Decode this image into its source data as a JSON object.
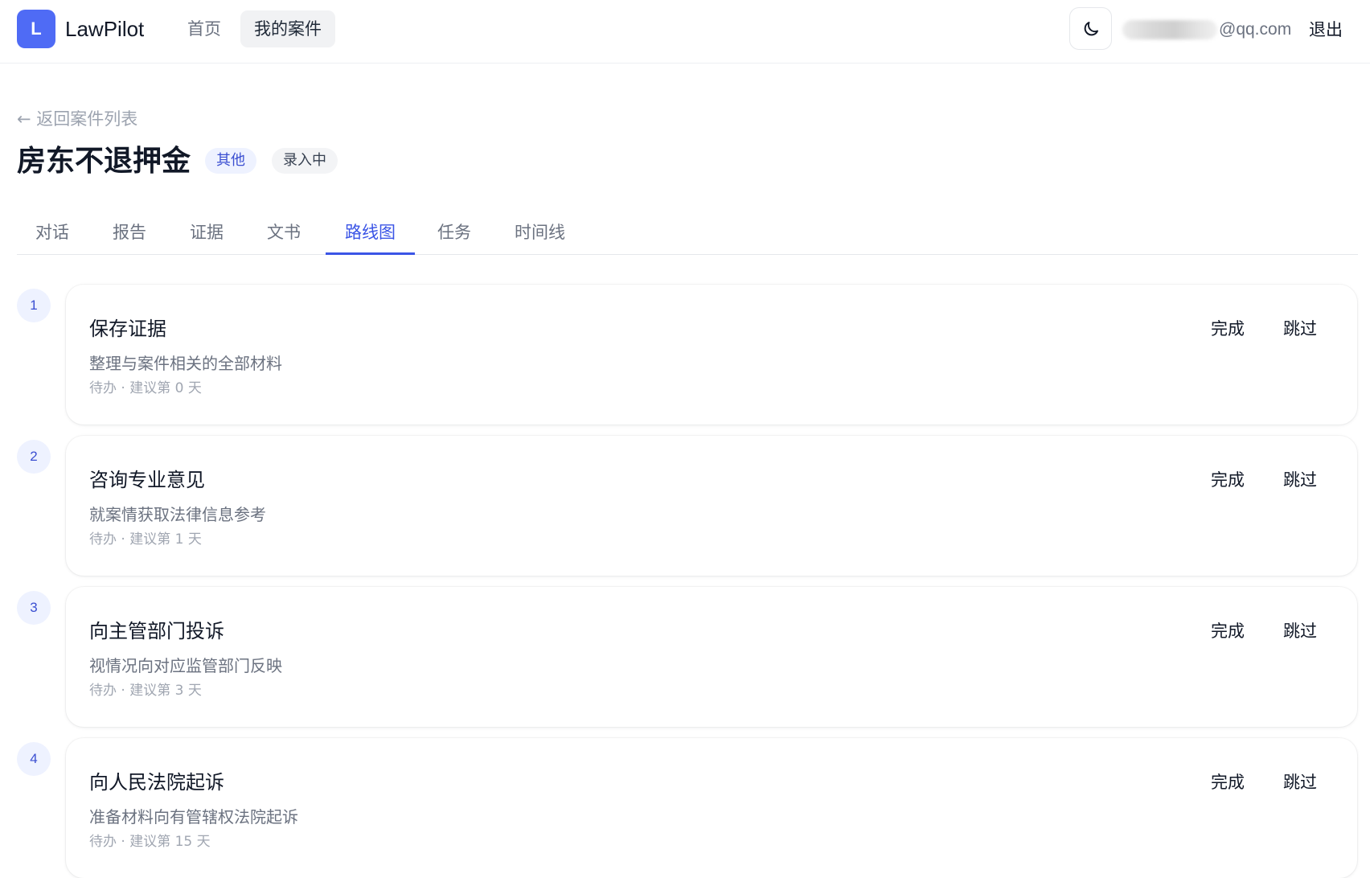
{
  "app": {
    "logo_letter": "L",
    "name": "LawPilot"
  },
  "nav": {
    "home": "首页",
    "my_cases": "我的案件"
  },
  "user": {
    "email_visible": "@qq.com",
    "logout": "退出"
  },
  "icons": {
    "theme": "moon-icon"
  },
  "case": {
    "back_label": "← 返回案件列表",
    "title": "房东不退押金",
    "type_badge": "其他",
    "status_badge": "录入中"
  },
  "tabs": [
    {
      "label": "对话"
    },
    {
      "label": "报告"
    },
    {
      "label": "证据"
    },
    {
      "label": "文书"
    },
    {
      "label": "路线图",
      "active": true
    },
    {
      "label": "任务"
    },
    {
      "label": "时间线"
    }
  ],
  "steps": [
    {
      "num": "1",
      "title": "保存证据",
      "desc": "整理与案件相关的全部材料",
      "meta": "待办 · 建议第 0 天",
      "complete": "完成",
      "skip": "跳过"
    },
    {
      "num": "2",
      "title": "咨询专业意见",
      "desc": "就案情获取法律信息参考",
      "meta": "待办 · 建议第 1 天",
      "complete": "完成",
      "skip": "跳过"
    },
    {
      "num": "3",
      "title": "向主管部门投诉",
      "desc": "视情况向对应监管部门反映",
      "meta": "待办 · 建议第 3 天",
      "complete": "完成",
      "skip": "跳过"
    },
    {
      "num": "4",
      "title": "向人民法院起诉",
      "desc": "准备材料向有管辖权法院起诉",
      "meta": "待办 · 建议第 15 天",
      "complete": "完成",
      "skip": "跳过"
    }
  ],
  "colors": {
    "accent": "#3b55e6",
    "logo_bg": "#4f6bf5",
    "badge_bg": "#eef2ff"
  }
}
